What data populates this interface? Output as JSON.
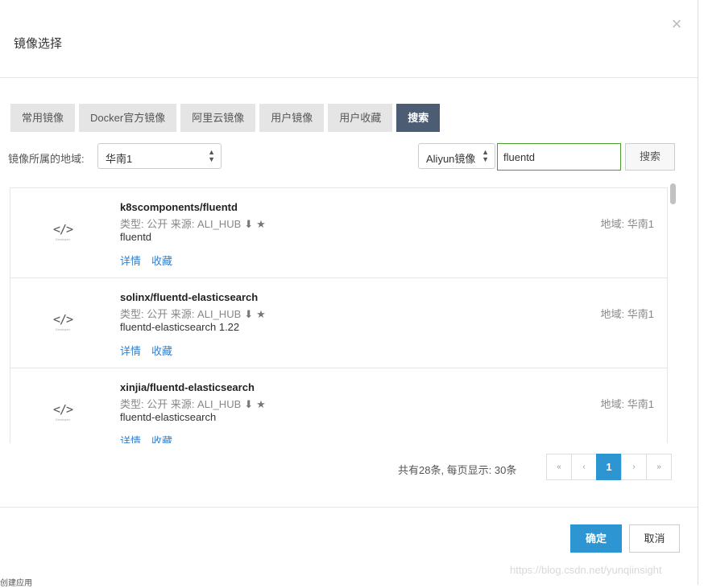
{
  "dialog": {
    "title": "镜像选择",
    "close_icon": "×"
  },
  "tabs": [
    {
      "label": "常用镜像"
    },
    {
      "label": "Docker官方镜像"
    },
    {
      "label": "阿里云镜像"
    },
    {
      "label": "用户镜像"
    },
    {
      "label": "用户收藏"
    },
    {
      "label": "搜索",
      "active": true
    }
  ],
  "filter": {
    "region_label": "镜像所属的地域:",
    "region_value": "华南1",
    "source_value": "Aliyun镜像",
    "search_value": "fluentd",
    "search_button": "搜索"
  },
  "results": [
    {
      "name": "k8scomponents/fluentd",
      "meta": "类型:  公开   来源:  ALI_HUB",
      "desc": "fluentd",
      "region": "地域:  华南1",
      "detail": "详情",
      "fav": "收藏",
      "logo": "</>",
      "logo_caption": "Developer"
    },
    {
      "name": "solinx/fluentd-elasticsearch",
      "meta": "类型:  公开   来源:  ALI_HUB",
      "desc": "fluentd-elasticsearch 1.22",
      "region": "地域:  华南1",
      "detail": "详情",
      "fav": "收藏",
      "logo": "</>",
      "logo_caption": "Developer"
    },
    {
      "name": "xinjia/fluentd-elasticsearch",
      "meta": "类型:  公开   来源:  ALI_HUB",
      "desc": "fluentd-elasticsearch",
      "region": "地域:  华南1",
      "detail": "详情",
      "fav": "收藏",
      "logo": "</>",
      "logo_caption": "Developer"
    }
  ],
  "pagination": {
    "summary": "共有28条,  每页显示:  30条",
    "first": "«",
    "prev": "‹",
    "current": "1",
    "next": "›",
    "last": "»"
  },
  "footer": {
    "ok": "确定",
    "cancel": "取消"
  },
  "watermark": "https://blog.csdn.net/yunqiinsight",
  "corner_text": "创建应用"
}
